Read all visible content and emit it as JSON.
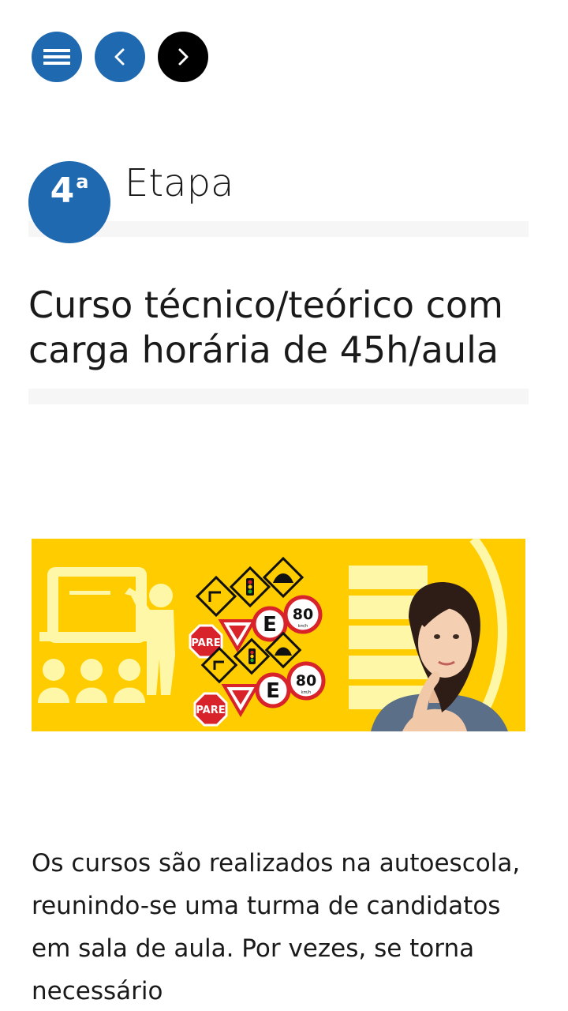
{
  "nav": {
    "menu_icon": "hamburger-menu-icon",
    "prev_icon": "chevron-left-icon",
    "next_icon": "chevron-right-icon",
    "menu_color": "#1f69b1",
    "prev_color": "#1f69b1",
    "next_color": "#000000"
  },
  "step": {
    "number": "4",
    "ordinal": "a",
    "title": "Etapa"
  },
  "course": {
    "heading": "Curso técnico/teórico com carga horária de 45h/aula"
  },
  "banner": {
    "background_color": "#ffcc00",
    "signs": {
      "pare_1": "PARE",
      "pare_2": "PARE",
      "speed_1": "80",
      "speed_2": "80",
      "speed_unit": "km/h",
      "parking_1": "E",
      "parking_2": "E"
    }
  },
  "description": {
    "text": "Os cursos são realizados na autoescola, reunindo-se uma turma de candidatos em sala de aula. Por vezes, se torna necessário"
  }
}
